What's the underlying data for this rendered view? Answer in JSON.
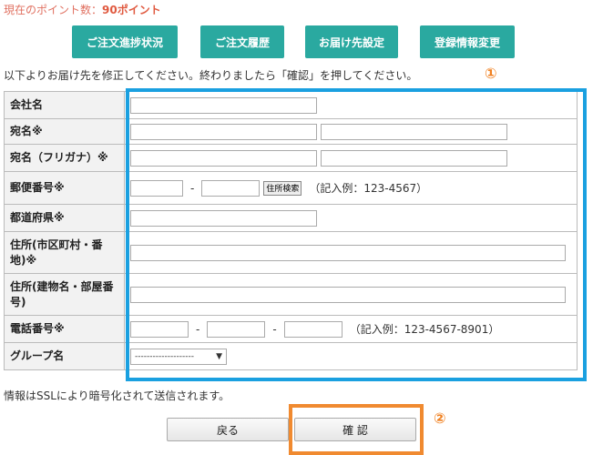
{
  "points": {
    "label": "現在のポイント数：",
    "value": "90ポイント"
  },
  "nav": [
    {
      "label": "ご注文進捗状況"
    },
    {
      "label": "ご注文履歴"
    },
    {
      "label": "お届け先設定"
    },
    {
      "label": "登録情報変更"
    }
  ],
  "instruction": "以下よりお届け先を修正してください。終わりましたら「確認」を押してください。",
  "markers": {
    "one": "①",
    "two": "②"
  },
  "form": {
    "company": {
      "label": "会社名"
    },
    "name": {
      "label": "宛名※"
    },
    "name_kana": {
      "label": "宛名（フリガナ）※"
    },
    "postal": {
      "label": "郵便番号※",
      "search_label": "住所検索",
      "dash": "-",
      "example": "（記入例：123-4567）"
    },
    "prefecture": {
      "label": "都道府県※"
    },
    "address1": {
      "label": "住所(市区町村・番地)※"
    },
    "address2": {
      "label": "住所(建物名・部屋番号)"
    },
    "phone": {
      "label": "電話番号※",
      "dash": "-",
      "example": "（記入例：123-4567-8901）"
    },
    "group": {
      "label": "グループ名",
      "selected": "--------------------"
    }
  },
  "ssl_note": "情報はSSLにより暗号化されて送信されます。",
  "buttons": {
    "back": "戻る",
    "confirm": "確 認"
  },
  "colors": {
    "nav_bg": "#2aa9a0",
    "highlight_blue": "#1aa0e0",
    "highlight_orange": "#f08a30",
    "points_text": "#e05a40"
  }
}
